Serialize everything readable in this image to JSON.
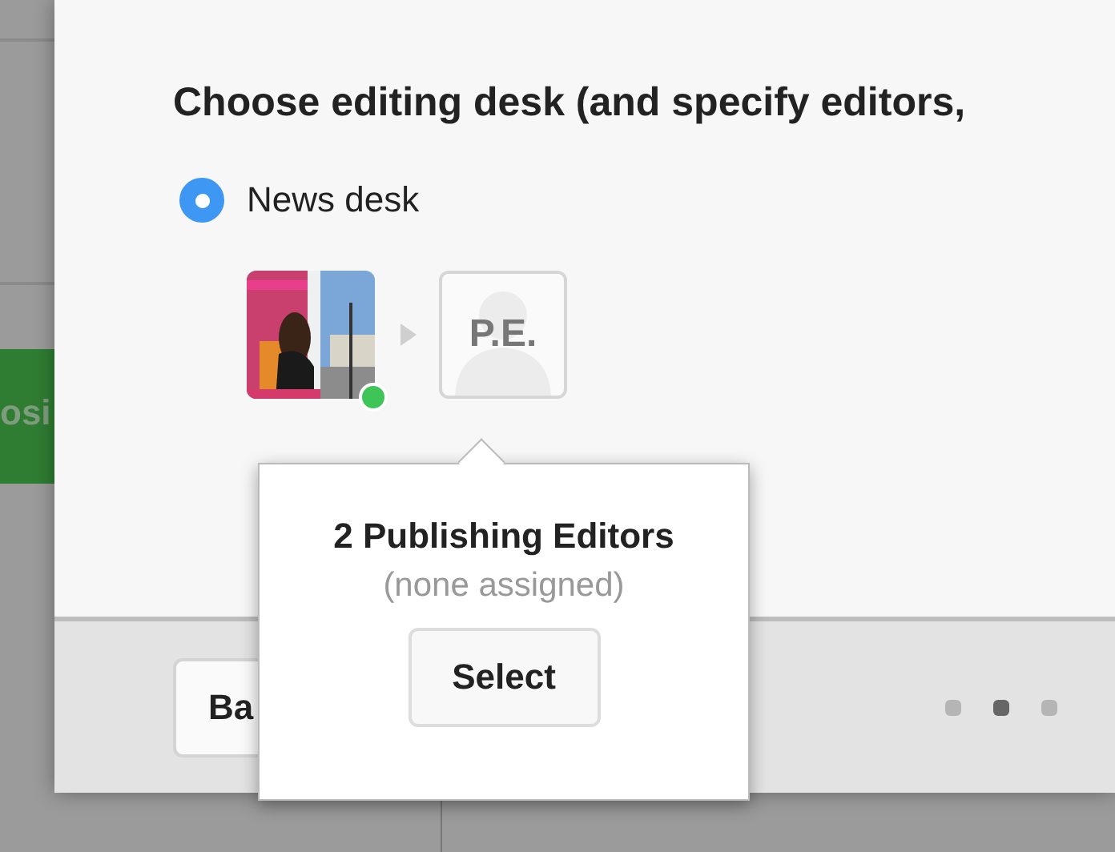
{
  "background": {
    "button": {
      "label": "osi"
    }
  },
  "dialog": {
    "title": "Choose editing desk (and specify editors,",
    "desks": [
      {
        "label": "News desk",
        "selected": true
      }
    ],
    "editor": {
      "online": true
    },
    "placeholder_avatar": {
      "initials": "P.E."
    },
    "popover": {
      "title": "2 Publishing Editors",
      "subtitle": "(none assigned)",
      "button": "Select"
    },
    "footer": {
      "back_button": "Ba",
      "pages": [
        {
          "selected": false
        },
        {
          "selected": true
        },
        {
          "selected": false
        }
      ]
    }
  }
}
